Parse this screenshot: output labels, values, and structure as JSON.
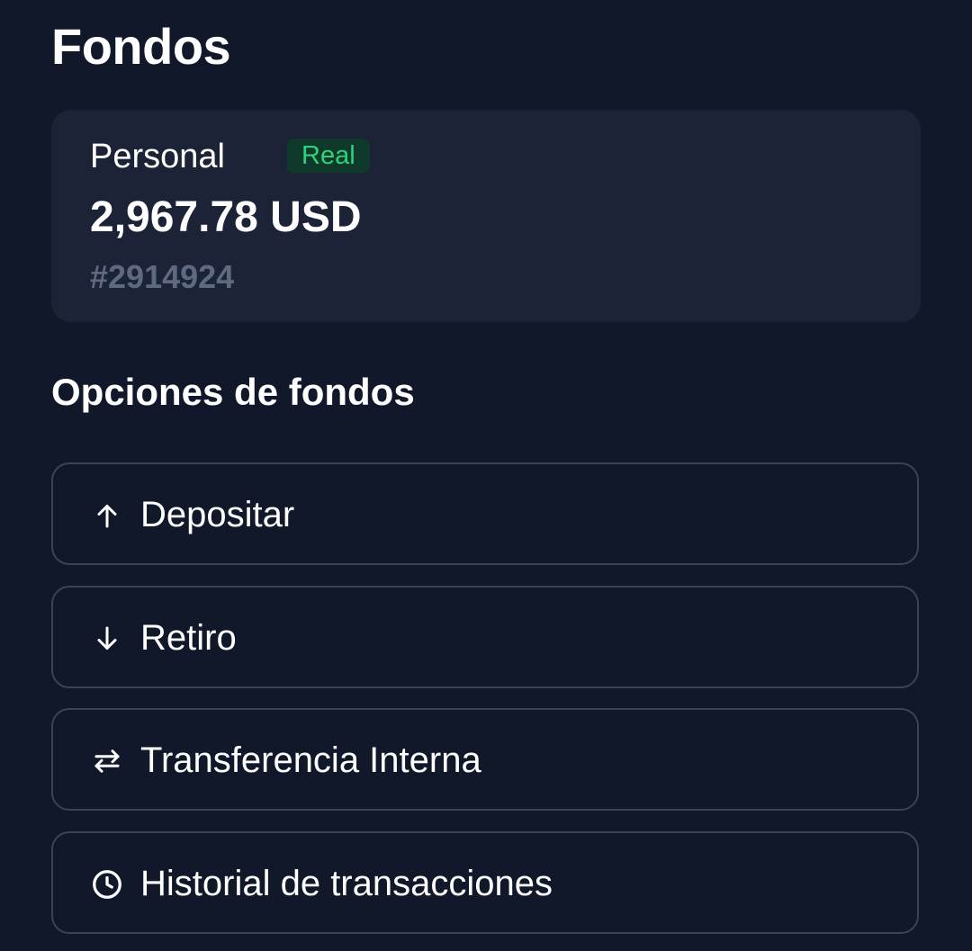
{
  "page": {
    "title": "Fondos"
  },
  "account": {
    "type_label": "Personal",
    "badge": "Real",
    "balance": "2,967.78 USD",
    "number": "#2914924"
  },
  "funding_options": {
    "title": "Opciones de fondos",
    "items": [
      {
        "label": "Depositar",
        "icon": "arrow-up-icon"
      },
      {
        "label": "Retiro",
        "icon": "arrow-down-icon"
      },
      {
        "label": "Transferencia Interna",
        "icon": "transfer-arrows-icon"
      },
      {
        "label": "Historial de transacciones",
        "icon": "clock-icon"
      }
    ]
  },
  "colors": {
    "background": "#10182a",
    "card": "#1c2336",
    "badge_bg": "#0f3a2b",
    "badge_text": "#2bd47a",
    "muted_text": "#5d6a82",
    "option_border": "#3a4457"
  }
}
